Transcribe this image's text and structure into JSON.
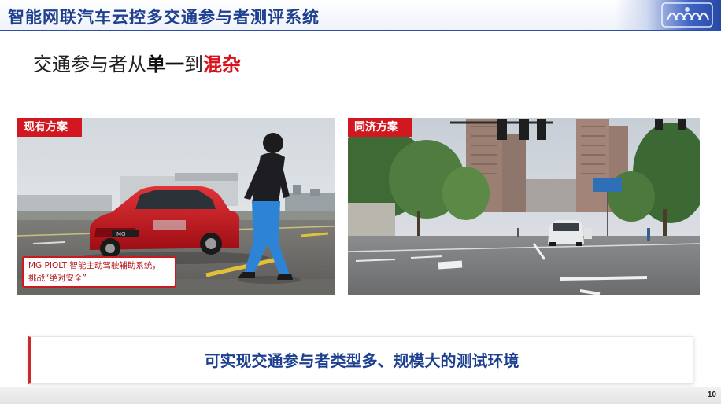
{
  "header": {
    "title": "智能网联汽车云控多交通参与者测评系统",
    "logo_icon": "university-crest-icon"
  },
  "heading": {
    "prefix": "交通参与者从",
    "bold1": "单一",
    "middle": "到",
    "highlight": "混杂"
  },
  "left_panel": {
    "tag": "现有方案",
    "caption_line1": "MG PIOLT 智能主动驾驶辅助系统，",
    "caption_line2": "挑战“绝对安全”",
    "plate_text": "MG"
  },
  "right_panel": {
    "tag": "同济方案"
  },
  "summary": {
    "text": "可实现交通参与者类型多、规模大的测试环境"
  },
  "footer": {
    "page_number": "10"
  },
  "colors": {
    "brand_blue": "#1f3f8f",
    "accent_red": "#d11820"
  }
}
